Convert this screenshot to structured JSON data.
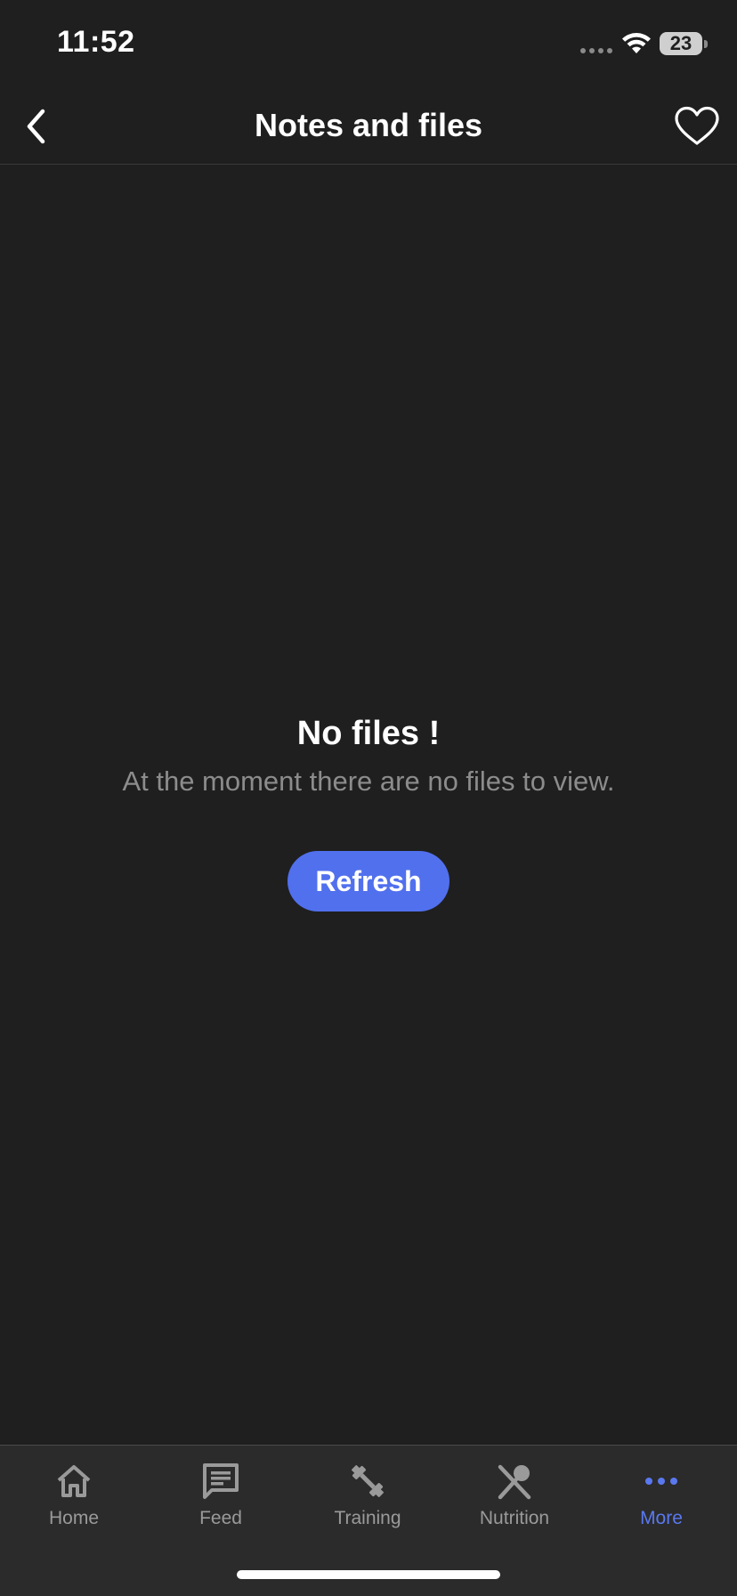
{
  "status_bar": {
    "time": "11:52",
    "battery": "23"
  },
  "header": {
    "title": "Notes and files"
  },
  "empty_state": {
    "title": "No files !",
    "message": "At the moment there are no files to view.",
    "refresh_label": "Refresh"
  },
  "tab_bar": {
    "items": [
      {
        "label": "Home",
        "icon": "home-icon"
      },
      {
        "label": "Feed",
        "icon": "feed-icon"
      },
      {
        "label": "Training",
        "icon": "dumbbell-icon"
      },
      {
        "label": "Nutrition",
        "icon": "utensils-icon"
      },
      {
        "label": "More",
        "icon": "more-icon"
      }
    ],
    "active_index": 4
  },
  "colors": {
    "background": "#1f1f1f",
    "accent": "#5170ee",
    "tab_bar_bg": "#2b2b2b",
    "inactive_tab": "#9a9a9a"
  }
}
